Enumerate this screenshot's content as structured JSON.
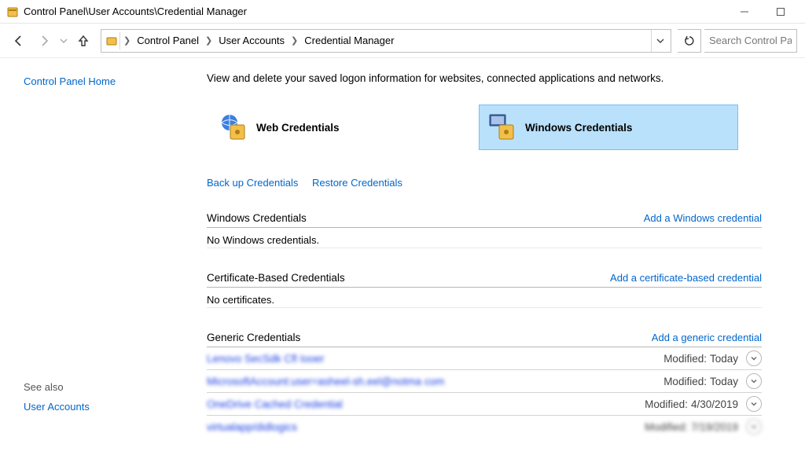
{
  "window": {
    "title": "Control Panel\\User Accounts\\Credential Manager"
  },
  "navbar": {
    "breadcrumbs": [
      "Control Panel",
      "User Accounts",
      "Credential Manager"
    ],
    "search_placeholder": "Search Control Pa"
  },
  "sidebar": {
    "home_link": "Control Panel Home",
    "see_also_title": "See also",
    "see_also_link": "User Accounts"
  },
  "main": {
    "intro": "View and delete your saved logon information for websites, connected applications and networks.",
    "tabs": {
      "web": "Web Credentials",
      "windows": "Windows Credentials"
    },
    "actions": {
      "backup": "Back up Credentials",
      "restore": "Restore Credentials"
    },
    "sections": [
      {
        "title": "Windows Credentials",
        "add": "Add a Windows credential",
        "empty": "No Windows credentials."
      },
      {
        "title": "Certificate-Based Credentials",
        "add": "Add a certificate-based credential",
        "empty": "No certificates."
      },
      {
        "title": "Generic Credentials",
        "add": "Add a generic credential"
      }
    ],
    "modified_label": "Modified:",
    "generic_items": [
      {
        "name": "Lenovo SecSdk Cfl Iooer",
        "date": "Today"
      },
      {
        "name": "MicrosoftAccount:user=asheel-sh.eel@notma com",
        "date": "Today"
      },
      {
        "name": "OneDrive Cached Credential",
        "date": "4/30/2019"
      },
      {
        "name": "virtualapp/didlogics",
        "date": "7/19/2019"
      }
    ]
  }
}
